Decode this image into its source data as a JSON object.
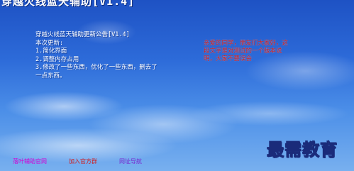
{
  "window": {
    "title": "穿越火线蓝天辅助[V1.4]"
  },
  "notice": {
    "heading": "穿越火线蓝天辅助更新公告[V1.4]",
    "intro": "本次更新:",
    "items": [
      "1.简化界面",
      "2.调整内存占用",
      "3.修改了一些东西，优化了一些东西，删去了一点东西。"
    ]
  },
  "side_note": "亲爱的同学，朋友们大家好，这段文字是对测试的一个版本说明，大家不要误会",
  "links": [
    {
      "label": "落叶辅助官网",
      "color": "#d400d4"
    },
    {
      "label": "加入官方群",
      "color": "#d21a1a"
    },
    {
      "label": "网址导航",
      "color": "#7a2ad0"
    }
  ],
  "watermark": "最需教育"
}
